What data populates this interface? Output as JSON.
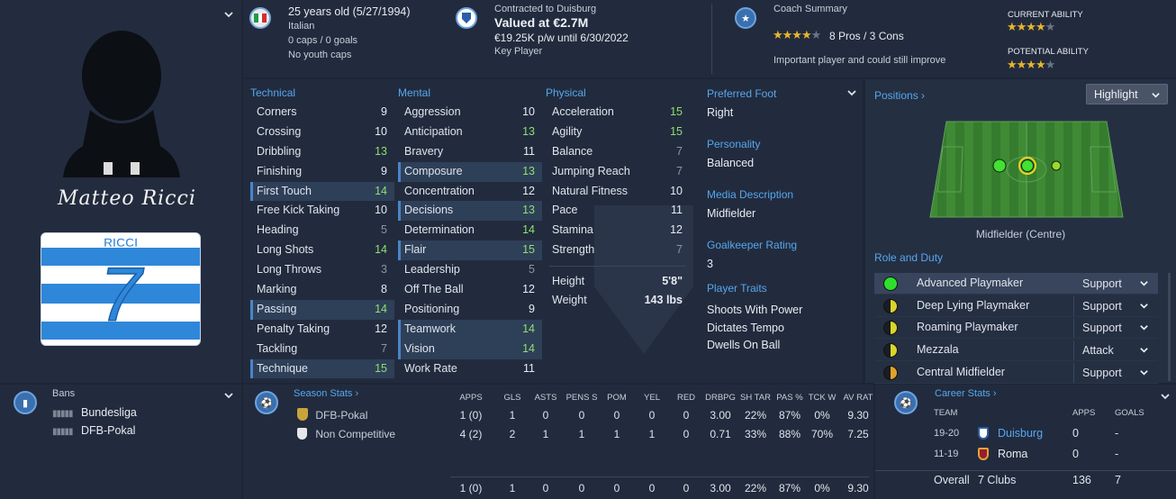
{
  "player": {
    "age_line": "25 years old (5/27/1994)",
    "nationality": "Italian",
    "caps": "0 caps / 0 goals",
    "youth_caps": "No youth caps",
    "signature": "Matteo Ricci",
    "shirt_name": "RICCI",
    "shirt_number": "7"
  },
  "contract": {
    "line1": "Contracted to Duisburg",
    "value": "Valued at €2.7M",
    "wage": "€19.25K p/w until 6/30/2022",
    "status": "Key Player"
  },
  "coach": {
    "title": "Coach Summary",
    "pros_cons": "8 Pros / 3 Cons",
    "summary": "Important player and could still improve",
    "stars_filled": 4,
    "stars_total": 5,
    "current_ability_label": "CURRENT ABILITY",
    "current_ability_stars": 4,
    "potential_ability_label": "POTENTIAL ABILITY",
    "potential_ability_stars": 4
  },
  "technical": {
    "header": "Technical",
    "rows": [
      {
        "label": "Corners",
        "value": "9",
        "tone": "white",
        "hl": false
      },
      {
        "label": "Crossing",
        "value": "10",
        "tone": "white",
        "hl": false
      },
      {
        "label": "Dribbling",
        "value": "13",
        "tone": "green",
        "hl": false
      },
      {
        "label": "Finishing",
        "value": "9",
        "tone": "white",
        "hl": false
      },
      {
        "label": "First Touch",
        "value": "14",
        "tone": "green",
        "hl": true
      },
      {
        "label": "Free Kick Taking",
        "value": "10",
        "tone": "white",
        "hl": false
      },
      {
        "label": "Heading",
        "value": "5",
        "tone": "grey",
        "hl": false
      },
      {
        "label": "Long Shots",
        "value": "14",
        "tone": "green",
        "hl": false
      },
      {
        "label": "Long Throws",
        "value": "3",
        "tone": "grey",
        "hl": false
      },
      {
        "label": "Marking",
        "value": "8",
        "tone": "white",
        "hl": false
      },
      {
        "label": "Passing",
        "value": "14",
        "tone": "green",
        "hl": true
      },
      {
        "label": "Penalty Taking",
        "value": "12",
        "tone": "white",
        "hl": false
      },
      {
        "label": "Tackling",
        "value": "7",
        "tone": "grey",
        "hl": false
      },
      {
        "label": "Technique",
        "value": "15",
        "tone": "green",
        "hl": true
      }
    ]
  },
  "mental": {
    "header": "Mental",
    "rows": [
      {
        "label": "Aggression",
        "value": "10",
        "tone": "white",
        "hl": false
      },
      {
        "label": "Anticipation",
        "value": "13",
        "tone": "green",
        "hl": false
      },
      {
        "label": "Bravery",
        "value": "11",
        "tone": "white",
        "hl": false
      },
      {
        "label": "Composure",
        "value": "13",
        "tone": "green",
        "hl": true
      },
      {
        "label": "Concentration",
        "value": "12",
        "tone": "white",
        "hl": false
      },
      {
        "label": "Decisions",
        "value": "13",
        "tone": "green",
        "hl": true
      },
      {
        "label": "Determination",
        "value": "14",
        "tone": "green",
        "hl": false
      },
      {
        "label": "Flair",
        "value": "15",
        "tone": "green",
        "hl": true
      },
      {
        "label": "Leadership",
        "value": "5",
        "tone": "grey",
        "hl": false
      },
      {
        "label": "Off The Ball",
        "value": "12",
        "tone": "white",
        "hl": false
      },
      {
        "label": "Positioning",
        "value": "9",
        "tone": "white",
        "hl": false
      },
      {
        "label": "Teamwork",
        "value": "14",
        "tone": "green",
        "hl": true
      },
      {
        "label": "Vision",
        "value": "14",
        "tone": "green",
        "hl": true
      },
      {
        "label": "Work Rate",
        "value": "11",
        "tone": "white",
        "hl": false
      }
    ]
  },
  "physical": {
    "header": "Physical",
    "rows": [
      {
        "label": "Acceleration",
        "value": "15",
        "tone": "green",
        "hl": false
      },
      {
        "label": "Agility",
        "value": "15",
        "tone": "green",
        "hl": false
      },
      {
        "label": "Balance",
        "value": "7",
        "tone": "grey",
        "hl": false
      },
      {
        "label": "Jumping Reach",
        "value": "7",
        "tone": "grey",
        "hl": false
      },
      {
        "label": "Natural Fitness",
        "value": "10",
        "tone": "white",
        "hl": false
      },
      {
        "label": "Pace",
        "value": "11",
        "tone": "white",
        "hl": false
      },
      {
        "label": "Stamina",
        "value": "12",
        "tone": "white",
        "hl": false
      },
      {
        "label": "Strength",
        "value": "7",
        "tone": "grey",
        "hl": false
      }
    ],
    "height_label": "Height",
    "height_value": "5'8\"",
    "weight_label": "Weight",
    "weight_value": "143 lbs"
  },
  "info": {
    "foot_label": "Preferred Foot",
    "foot_value": "Right",
    "personality_label": "Personality",
    "personality_value": "Balanced",
    "media_label": "Media Description",
    "media_value": "Midfielder",
    "gk_label": "Goalkeeper Rating",
    "gk_value": "3",
    "traits_label": "Player Traits",
    "traits": [
      "Shoots With Power",
      "Dictates Tempo",
      "Dwells On Ball"
    ]
  },
  "positions": {
    "label": "Positions",
    "highlight_button": "Highlight",
    "position_name": "Midfielder (Centre)",
    "role_duty_label": "Role and Duty",
    "roles": [
      {
        "name": "Advanced Playmaker",
        "duty": "Support",
        "dot": "#2ee02b",
        "selected": true
      },
      {
        "name": "Deep Lying Playmaker",
        "duty": "Support",
        "dot": "half",
        "selected": false
      },
      {
        "name": "Roaming Playmaker",
        "duty": "Support",
        "dot": "half",
        "selected": false
      },
      {
        "name": "Mezzala",
        "duty": "Attack",
        "dot": "half",
        "selected": false
      },
      {
        "name": "Central Midfielder",
        "duty": "Support",
        "dot": "half-orange",
        "selected": false
      }
    ]
  },
  "bans": {
    "title": "Bans",
    "items": [
      "Bundesliga",
      "DFB-Pokal"
    ]
  },
  "season_stats": {
    "title": "Season Stats",
    "columns": [
      "APPS",
      "GLS",
      "ASTS",
      "PENS S",
      "POM",
      "YEL",
      "RED",
      "DRBPG",
      "SH TAR",
      "PAS %",
      "TCK W",
      "AV RAT"
    ],
    "rows": [
      {
        "competition": "DFB-Pokal",
        "values": [
          "1 (0)",
          "1",
          "0",
          "0",
          "0",
          "0",
          "0",
          "3.00",
          "22%",
          "87%",
          "0%",
          "9.30"
        ]
      },
      {
        "competition": "Non Competitive",
        "values": [
          "4 (2)",
          "2",
          "1",
          "1",
          "1",
          "1",
          "0",
          "0.71",
          "33%",
          "88%",
          "70%",
          "7.25"
        ]
      }
    ],
    "total": [
      "1 (0)",
      "1",
      "0",
      "0",
      "0",
      "0",
      "0",
      "3.00",
      "22%",
      "87%",
      "0%",
      "9.30"
    ]
  },
  "career_stats": {
    "title": "Career Stats",
    "col_team": "TEAM",
    "col_apps": "APPS",
    "col_goals": "GOALS",
    "rows": [
      {
        "season": "19-20",
        "club": "Duisburg",
        "apps": "0",
        "goals": "-"
      },
      {
        "season": "11-19",
        "club": "Roma",
        "apps": "0",
        "goals": "-"
      }
    ],
    "overall_label": "Overall",
    "overall_clubs": "7 Clubs",
    "overall_apps": "136",
    "overall_goals": "7"
  },
  "colors": {
    "accent_blue": "#55a7ef",
    "green_attr": "#8fdf6f",
    "panel_bg": "#222b3d"
  }
}
